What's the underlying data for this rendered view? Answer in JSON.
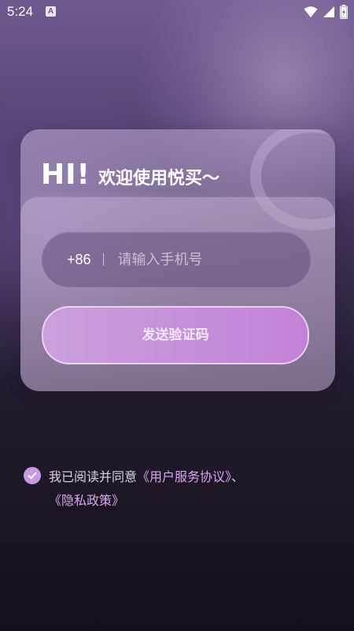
{
  "status_bar": {
    "time": "5:24",
    "notification_letter": "A",
    "icons": [
      "wifi-icon",
      "signal-icon",
      "battery-icon"
    ]
  },
  "login_card": {
    "greeting_hi": "HI!",
    "greeting_text": "欢迎使用悦买～",
    "country_code": "+86",
    "phone_placeholder": "请输入手机号",
    "phone_value": "",
    "send_code_label": "发送验证码"
  },
  "agreement": {
    "checked": true,
    "prefix": "我已阅读并同意",
    "user_agreement_link": "《用户服务协议》",
    "separator": "、",
    "privacy_link": "《隐私政策》"
  },
  "colors": {
    "accent": "#c99ae2",
    "link": "#d9a6ef",
    "button_start": "#caa0dc",
    "button_end": "#c282d8"
  }
}
